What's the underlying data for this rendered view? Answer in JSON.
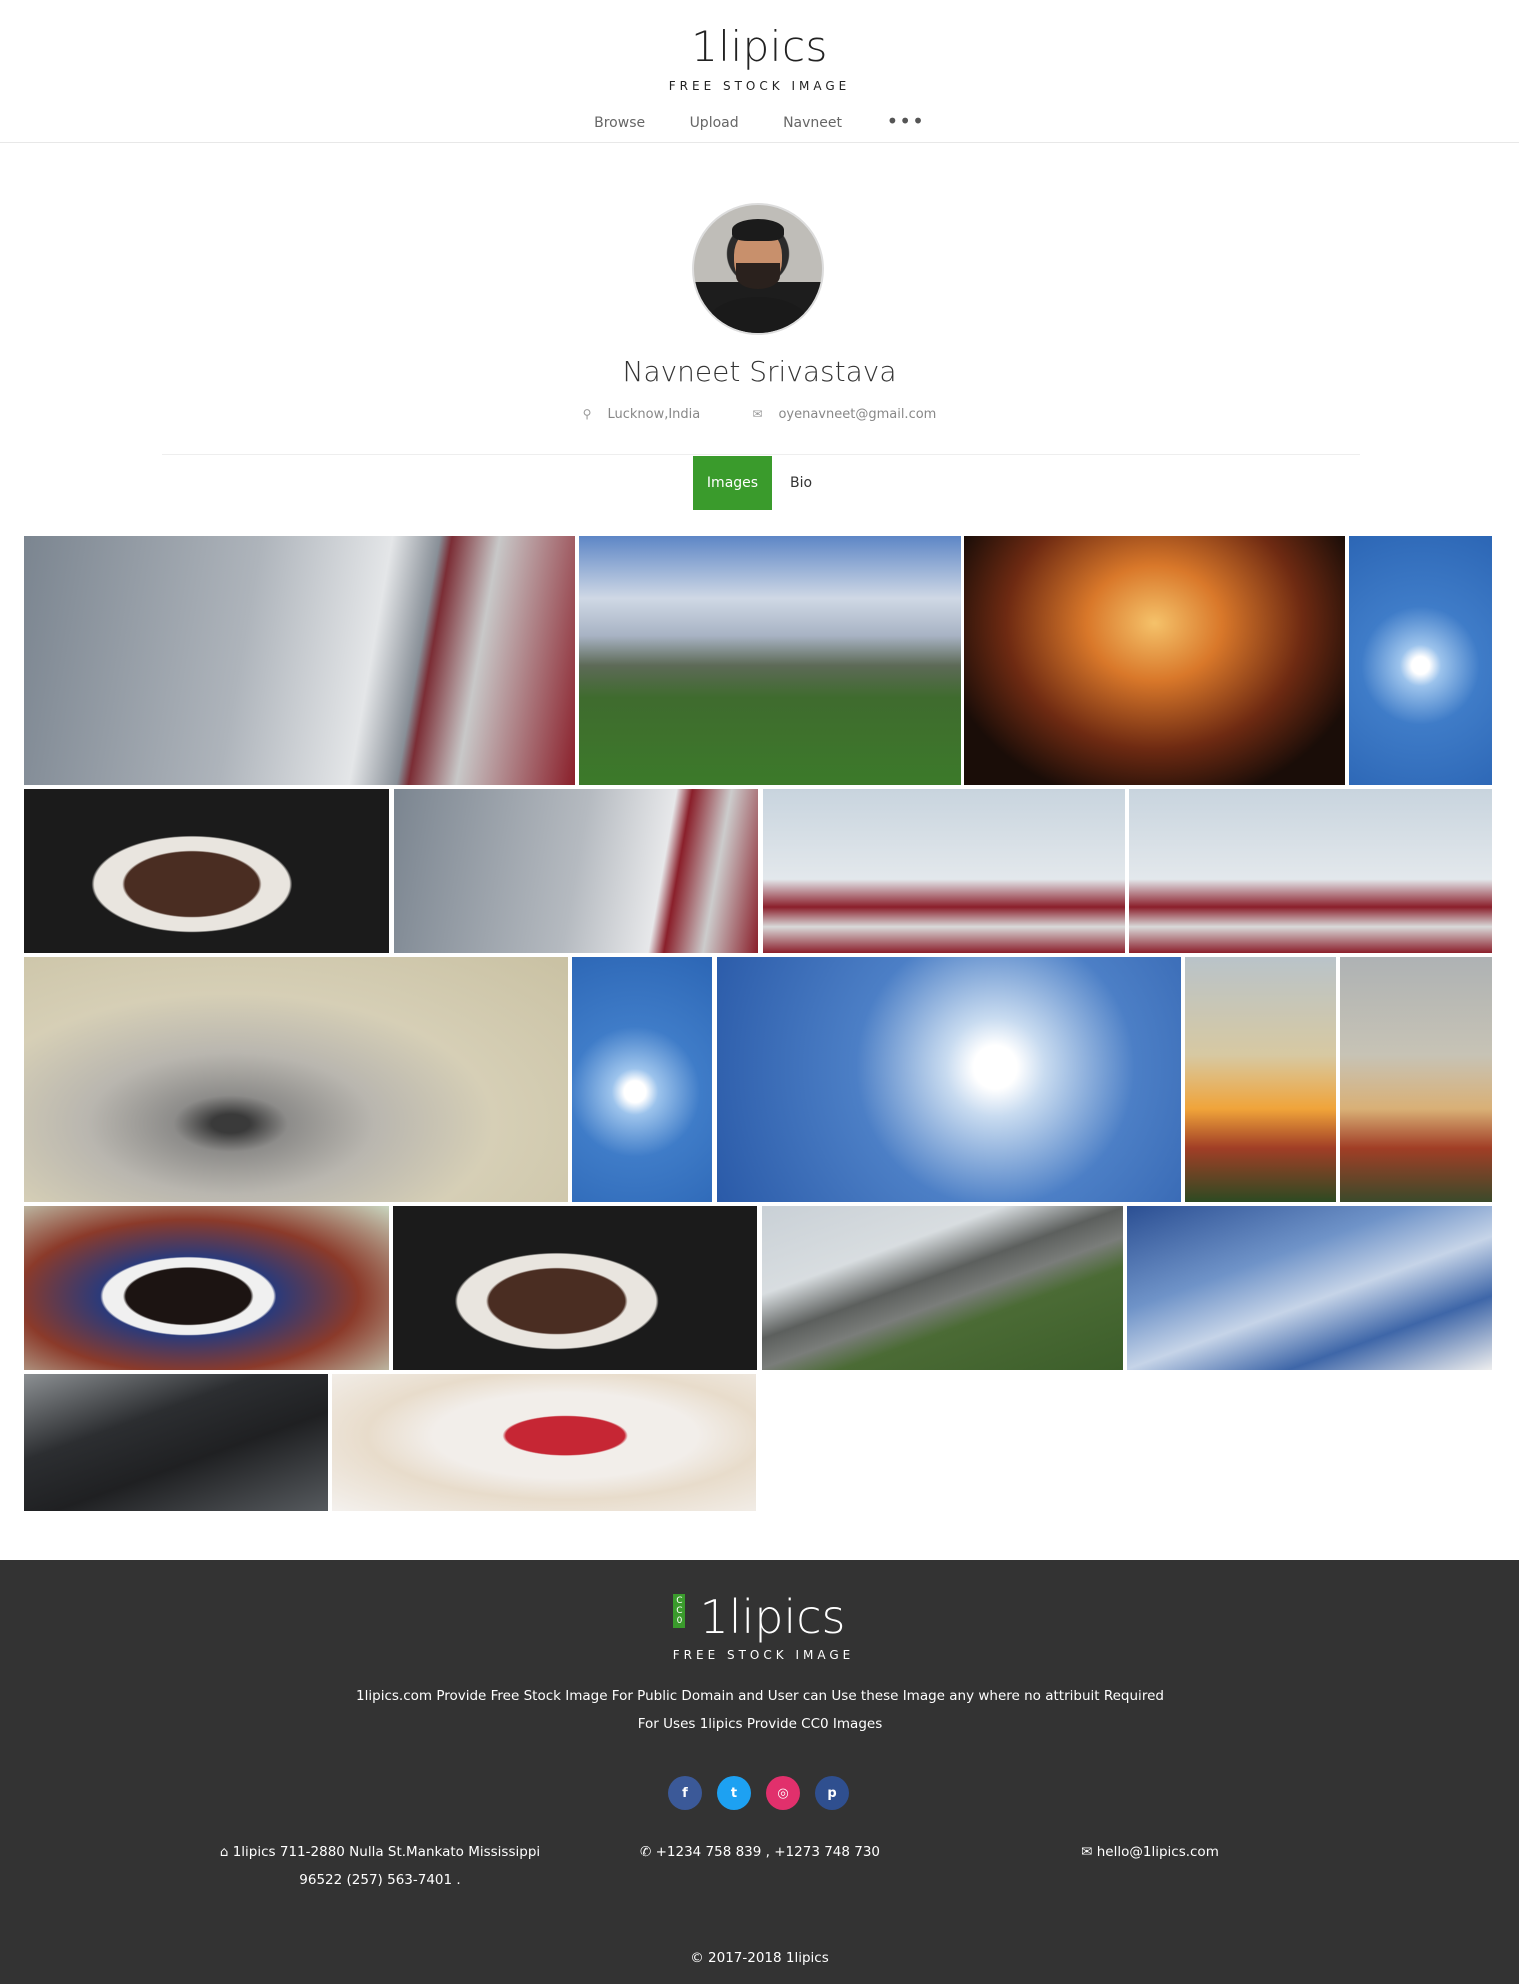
{
  "header": {
    "logo_title": "1lipics",
    "logo_subtitle": "FREE STOCK IMAGE",
    "nav": [
      "Browse",
      "Upload",
      "Navneet"
    ],
    "more_label": "•••"
  },
  "profile": {
    "name": "Navneet Srivastava",
    "location": "Lucknow,India",
    "email": "oyenavneet@gmail.com",
    "tabs": {
      "active": "Images",
      "other": "Bio"
    }
  },
  "gallery": {
    "images": [
      {
        "name": "sky-building-bird-1"
      },
      {
        "name": "poppy-field"
      },
      {
        "name": "concert-crowd"
      },
      {
        "name": "sun-sky-1"
      },
      {
        "name": "cake-navneet-1"
      },
      {
        "name": "sky-building-bird-2"
      },
      {
        "name": "red-building-sky-1"
      },
      {
        "name": "red-building-sky-2"
      },
      {
        "name": "spiral-blur"
      },
      {
        "name": "sun-sky-2"
      },
      {
        "name": "clouds-sun"
      },
      {
        "name": "sunset-building-1"
      },
      {
        "name": "sunset-building-2"
      },
      {
        "name": "cake-party"
      },
      {
        "name": "cake-navneet-2"
      },
      {
        "name": "road-greenery"
      },
      {
        "name": "wispy-clouds"
      },
      {
        "name": "keyboard"
      },
      {
        "name": "gift-heart"
      }
    ]
  },
  "footer": {
    "cc0": "CC0",
    "logo_title": "1lipics",
    "logo_subtitle": "FREE STOCK IMAGE",
    "description_line1": "1lipics.com Provide Free Stock Image For Public Domain and User can Use these Image any where no attribuit Required",
    "description_line2": "For Uses 1lipics Provide CC0 Images",
    "address_line1": "1lipics 711-2880 Nulla St.Mankato Mississippi",
    "address_line2": "96522 (257) 563-7401 .",
    "phone": "+1234 758 839 , +1273 748 730",
    "email": "hello@1lipics.com",
    "copyright": "© 2017-2018 1lipics",
    "social": [
      {
        "name": "facebook",
        "glyph": "f",
        "color": "#3b5998"
      },
      {
        "name": "twitter",
        "glyph": "t",
        "color": "#1da1f2"
      },
      {
        "name": "instagram",
        "glyph": "◎",
        "color": "#e1306c"
      },
      {
        "name": "pinterest",
        "glyph": "p",
        "color": "#2f4f8f"
      }
    ]
  },
  "colors": {
    "accent": "#3a9b2c",
    "footer_bg": "#333333"
  }
}
